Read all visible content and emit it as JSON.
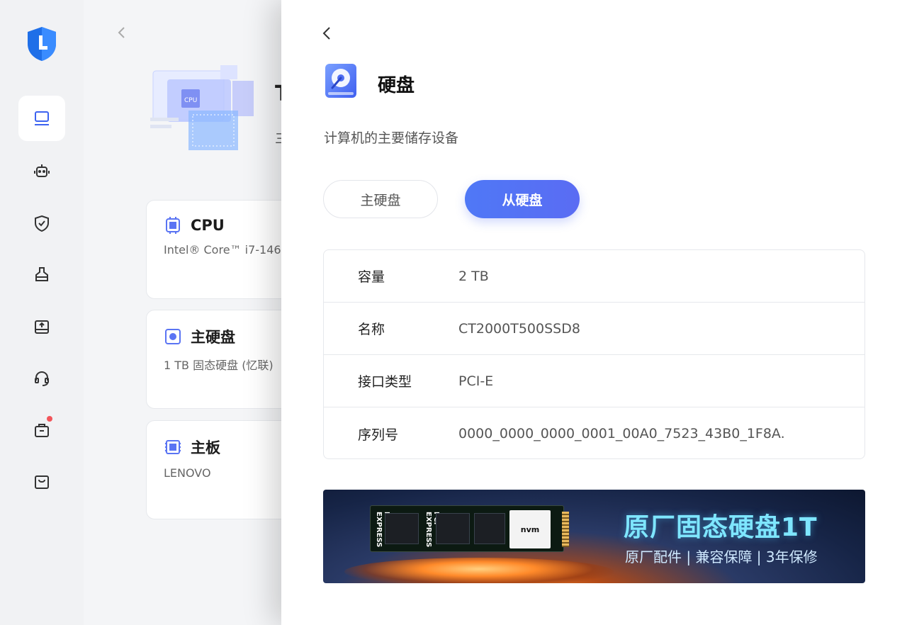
{
  "background_page": {
    "title_partial": "T",
    "sub_partial": "三",
    "cards": [
      {
        "title": "CPU",
        "desc": "Intel® Core™ i7-146"
      },
      {
        "title": "主硬盘",
        "desc": "1 TB 固态硬盘 (忆联)"
      },
      {
        "title": "主板",
        "desc": "LENOVO"
      }
    ]
  },
  "drawer": {
    "title": "硬盘",
    "subtitle": "计算机的主要储存设备",
    "tabs": {
      "primary": "主硬盘",
      "secondary": "从硬盘"
    },
    "rows": [
      {
        "key": "容量",
        "value": "2 TB"
      },
      {
        "key": "名称",
        "value": "CT2000T500SSD8"
      },
      {
        "key": "接口类型",
        "value": "PCI-E"
      },
      {
        "key": "序列号",
        "value": "0000_0000_0000_0001_00A0_7523_43B0_1F8A."
      }
    ],
    "banner": {
      "title": "原厂固态硬盘1T",
      "subtitle": "原厂配件 | 兼容保障 | 3年保修",
      "stick_text": "nvm",
      "pci_text": "PCI EXPRESS"
    }
  },
  "colors": {
    "accent": "#4f78f6",
    "logo": "#1f6fe8"
  },
  "icons": [
    "shield-logo-icon",
    "monitor-icon",
    "robot-icon",
    "shield-check-icon",
    "clean-icon",
    "drive-upload-icon",
    "headset-icon",
    "toolbox-icon",
    "bag-icon",
    "chevron-left-icon",
    "hard-disk-icon",
    "cpu-icon",
    "motherboard-icon"
  ]
}
